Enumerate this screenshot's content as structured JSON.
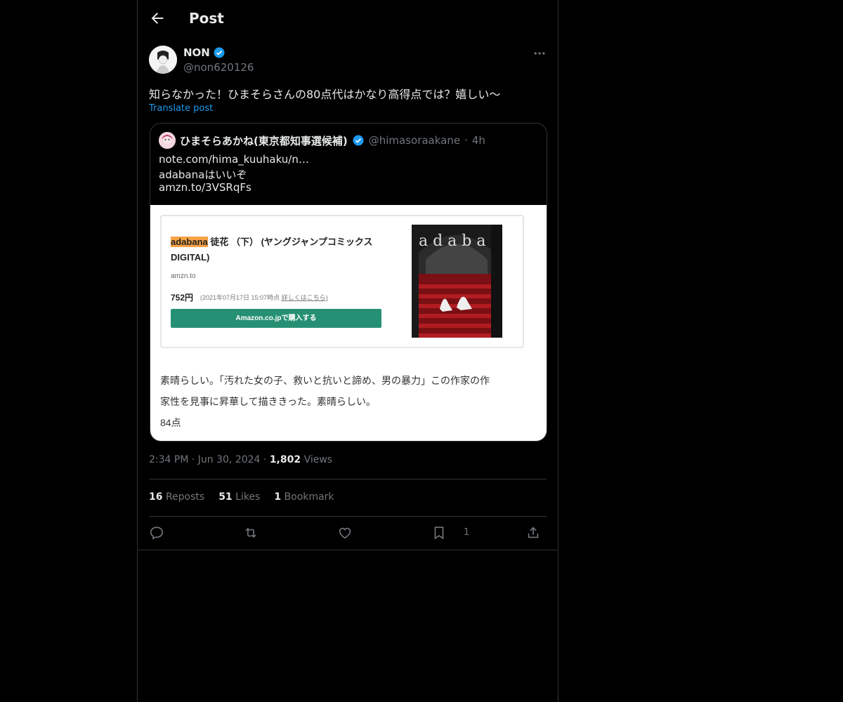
{
  "header": {
    "title": "Post"
  },
  "post": {
    "author": {
      "name": "NON",
      "handle": "@non620126"
    },
    "text": "知らなかった！ひまそらさんの80点代はかなり高得点では？嬉しい〜",
    "translate_label": "Translate post",
    "timestamp": {
      "time": "2:34 PM",
      "date": "Jun 30, 2024"
    },
    "views_count": "1,802",
    "views_label": "Views",
    "reposts_count": "16",
    "reposts_label": "Reposts",
    "likes_count": "51",
    "likes_label": "Likes",
    "bookmarks_count": "1",
    "bookmarks_label": "Bookmark",
    "bookmark_action_count": "1"
  },
  "quote": {
    "author": {
      "name": "ひまそらあかね(東京都知事選候補)",
      "handle": "@himasoraakane",
      "time": "4h"
    },
    "lines": [
      "note.com/hima_kuuhaku/n…",
      "adabanaはいいぞ",
      "amzn.to/3VSRqFs"
    ],
    "card": {
      "title_highlight": "adabana",
      "title_rest": " 徒花 （下） (ヤングジャンプコミックスDIGITAL)",
      "domain": "amzn.to",
      "price": "752円",
      "price_date": "(2021年07月17日 15:07時点 ",
      "price_detail": "詳しくはこちら)",
      "button": "Amazon.co.jpで購入する"
    },
    "review": [
      "素晴らしい。「汚れた女の子、救いと抗いと諦め、男の暴力」この作家の作",
      "家性を見事に昇華して描ききった。素晴らしい。",
      "84点"
    ]
  },
  "colors": {
    "accent": "#1d9bf0",
    "amazon_button": "#269074",
    "highlight": "#f7a245"
  },
  "icons": [
    "back-arrow-icon",
    "verified-icon",
    "more-icon",
    "reply-icon",
    "repost-icon",
    "like-icon",
    "bookmark-icon",
    "share-icon"
  ]
}
